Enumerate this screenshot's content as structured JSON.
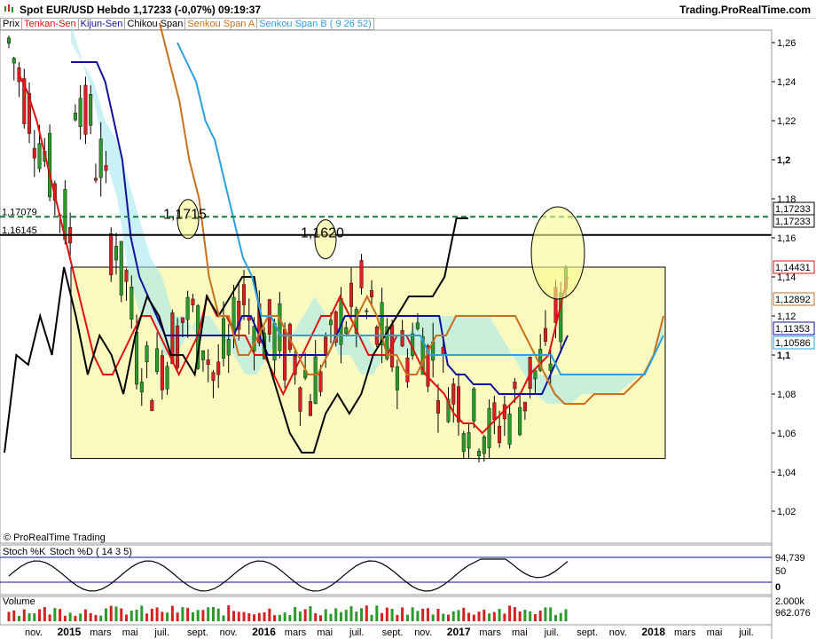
{
  "header": {
    "title": "Spot EUR/USD   Hebdo   1,17233 (-0,07%)   09:19:37",
    "brand": "Trading.ProRealTime.com"
  },
  "legend": [
    {
      "label": "Prix",
      "color": "#000000"
    },
    {
      "label": "Tenkan-Sen",
      "color": "#e01010"
    },
    {
      "label": "Kijun-Sen",
      "color": "#1010a0"
    },
    {
      "label": "Chikou Span",
      "color": "#000000"
    },
    {
      "label": "Senkou Span A",
      "color": "#c8701a"
    },
    {
      "label": "Senkou Span B ( 9 26 52)",
      "color": "#2aa0e0"
    }
  ],
  "watermark": "© ProRealTime Trading",
  "stoch_panel": {
    "label_k": "Stoch %K",
    "label_d": "Stoch %D ( 14 3 5)",
    "value": "94,739",
    "ticks": [
      "50",
      "0"
    ]
  },
  "volume_panel": {
    "label": "Volume",
    "tick": "2.000k",
    "value": "962.076"
  },
  "chart_data": {
    "type": "candlestick",
    "title": "Spot EUR/USD Hebdo",
    "ylim": [
      1.0,
      1.27
    ],
    "yticks": [
      "1,26",
      "1,24",
      "1,22",
      "1,2",
      "1,18",
      "1,16",
      "1,14",
      "1,12",
      "1,1",
      "1,08",
      "1,06",
      "1,04",
      "1,02"
    ],
    "xticks": [
      "nov.",
      "2015",
      "mars",
      "mai",
      "juil.",
      "sept.",
      "nov.",
      "2016",
      "mars",
      "mai",
      "juil.",
      "sept.",
      "nov.",
      "2017",
      "mars",
      "mai",
      "juil.",
      "sept.",
      "nov.",
      "2018",
      "mars",
      "mai",
      "juil."
    ],
    "bold_xticks": [
      "2015",
      "2016",
      "2017",
      "2018"
    ],
    "hlines": [
      {
        "label": "1,17079",
        "value": 1.17079,
        "style": "dashed",
        "color": "#1a7a3a"
      },
      {
        "label": "1,16145",
        "value": 1.16145,
        "style": "solid",
        "color": "#000000"
      }
    ],
    "annotations": [
      {
        "text": "1,1715",
        "value": 1.1715
      },
      {
        "text": "1,1620",
        "value": 1.162
      }
    ],
    "range_box": {
      "top": 1.145,
      "bottom": 1.047
    },
    "price_badges": [
      {
        "label": "1,17233",
        "color": "#000000"
      },
      {
        "label": "1,17233",
        "color": "#000000"
      },
      {
        "label": "1,14431",
        "color": "#e01010"
      },
      {
        "label": "1,12892",
        "color": "#c8701a"
      },
      {
        "label": "1,11353",
        "color": "#1010a0"
      },
      {
        "label": "1,10586",
        "color": "#2aa0e0"
      }
    ],
    "series": [
      {
        "name": "Tenkan-Sen",
        "color": "#e01010",
        "values": [
          1.245,
          1.235,
          1.22,
          1.2,
          1.18,
          1.16,
          1.14,
          1.12,
          1.1,
          1.09,
          1.09,
          1.1,
          1.11,
          1.12,
          1.12,
          1.11,
          1.1,
          1.09,
          1.1,
          1.11,
          1.13,
          1.12,
          1.12,
          1.11,
          1.11,
          1.1,
          1.1,
          1.09,
          1.08,
          1.09,
          1.1,
          1.11,
          1.12,
          1.12,
          1.13,
          1.12,
          1.11,
          1.1,
          1.1,
          1.1,
          1.11,
          1.11,
          1.1,
          1.09,
          1.085,
          1.08,
          1.07,
          1.065,
          1.065,
          1.06,
          1.065,
          1.07,
          1.075,
          1.08,
          1.09,
          1.095,
          1.1,
          1.12,
          1.14
        ]
      },
      {
        "name": "Kijun-Sen",
        "color": "#1010a0",
        "values": [
          1.25,
          1.25,
          1.25,
          1.25,
          1.24,
          1.22,
          1.2,
          1.16,
          1.14,
          1.13,
          1.12,
          1.11,
          1.11,
          1.11,
          1.11,
          1.11,
          1.11,
          1.11,
          1.11,
          1.11,
          1.12,
          1.12,
          1.11,
          1.1,
          1.1,
          1.1,
          1.1,
          1.1,
          1.1,
          1.1,
          1.1,
          1.11,
          1.12,
          1.12,
          1.12,
          1.12,
          1.12,
          1.12,
          1.12,
          1.12,
          1.12,
          1.12,
          1.12,
          1.12,
          1.095,
          1.09,
          1.09,
          1.085,
          1.085,
          1.085,
          1.08,
          1.08,
          1.08,
          1.08,
          1.08,
          1.08,
          1.09,
          1.1,
          1.11
        ]
      },
      {
        "name": "Chikou Span",
        "color": "#000000",
        "values": [
          1.05,
          1.1,
          1.095,
          1.12,
          1.1,
          1.145,
          1.12,
          1.09,
          1.11,
          1.1,
          1.08,
          1.11,
          1.13,
          1.12,
          1.1,
          1.1,
          1.09,
          1.13,
          1.12,
          1.13,
          1.14,
          1.14,
          1.1,
          1.08,
          1.06,
          1.05,
          1.05,
          1.07,
          1.08,
          1.07,
          1.08,
          1.1,
          1.11,
          1.12,
          1.13,
          1.13,
          1.13,
          1.14,
          1.17,
          1.17
        ]
      },
      {
        "name": "Senkou Span A",
        "color": "#c8701a",
        "values": [
          1.27,
          1.25,
          1.23,
          1.2,
          1.18,
          1.14,
          1.12,
          1.12,
          1.1,
          1.1,
          1.11,
          1.12,
          1.12,
          1.11,
          1.1,
          1.09,
          1.09,
          1.1,
          1.11,
          1.11,
          1.12,
          1.13,
          1.12,
          1.1,
          1.1,
          1.09,
          1.09,
          1.1,
          1.11,
          1.11,
          1.12,
          1.12,
          1.12,
          1.12,
          1.12,
          1.12,
          1.12,
          1.11,
          1.1,
          1.09,
          1.08,
          1.075,
          1.075,
          1.075,
          1.08,
          1.08,
          1.08,
          1.08,
          1.085,
          1.09,
          1.1,
          1.12
        ]
      },
      {
        "name": "Senkou Span B",
        "color": "#2aa0e0",
        "values": [
          1.26,
          1.25,
          1.24,
          1.22,
          1.21,
          1.19,
          1.17,
          1.15,
          1.14,
          1.12,
          1.12,
          1.11,
          1.11,
          1.11,
          1.11,
          1.11,
          1.11,
          1.11,
          1.11,
          1.11,
          1.11,
          1.11,
          1.11,
          1.11,
          1.11,
          1.11,
          1.11,
          1.1,
          1.1,
          1.1,
          1.1,
          1.1,
          1.1,
          1.1,
          1.1,
          1.1,
          1.1,
          1.1,
          1.1,
          1.1,
          1.1,
          1.09,
          1.09,
          1.09,
          1.09,
          1.09,
          1.09,
          1.09,
          1.09,
          1.09,
          1.09,
          1.1,
          1.11
        ]
      }
    ]
  }
}
